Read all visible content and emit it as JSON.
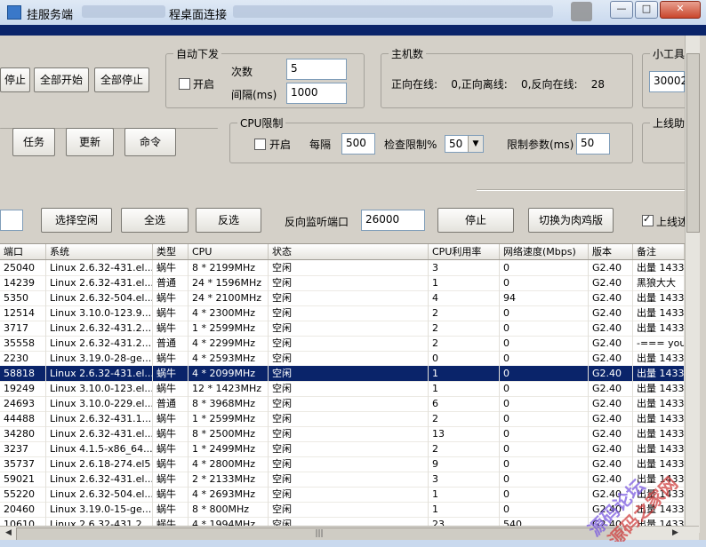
{
  "window": {
    "title_left": "挂服务端",
    "title_right": "程桌面连接"
  },
  "toolbar": {
    "btn_stop_partial": "停止",
    "btn_start_all": "全部开始",
    "btn_stop_all": "全部停止",
    "btn_task": "任务",
    "btn_update": "更新",
    "btn_command": "命令"
  },
  "auto_dispatch": {
    "legend": "自动下发",
    "enable_label": "开启",
    "count_label": "次数",
    "count_value": "5",
    "interval_label": "间隔(ms)",
    "interval_value": "1000"
  },
  "hosts": {
    "legend": "主机数",
    "stats": "正向在线:    0,正向离线:    0,反向在线:    28"
  },
  "tools": {
    "legend_partial": "小工具",
    "value": "30002"
  },
  "cpu_limit": {
    "legend": "CPU限制",
    "enable_label": "开启",
    "every_label": "每隔",
    "every_value": "500",
    "check_label": "检查限制%",
    "check_value": "50",
    "param_label": "限制参数(ms)",
    "param_value": "50"
  },
  "online_assist": {
    "legend_partial": "上线助"
  },
  "row3": {
    "select_idle": "选择空闲",
    "select_all": "全选",
    "invert": "反选",
    "listen_label": "反向监听端口",
    "listen_value": "26000",
    "stop": "停止",
    "switch": "切换为肉鸡版",
    "online_label": "上线述"
  },
  "table": {
    "headers": [
      "端口",
      "系统",
      "类型",
      "CPU",
      "状态",
      "CPU利用率",
      "网络速度(Mbps)",
      "版本",
      "备注"
    ],
    "rows": [
      [
        "25040",
        "Linux 2.6.32-431.el...",
        "蜗牛",
        "8 * 2199MHz",
        "空闲",
        "3",
        "0",
        "G2.40",
        "出量 1433"
      ],
      [
        "14239",
        "Linux 2.6.32-431.el...",
        "普通",
        "24 * 1596MHz",
        "空闲",
        "1",
        "0",
        "G2.40",
        "黑狼大大"
      ],
      [
        "5350",
        "Linux 2.6.32-504.el...",
        "蜗牛",
        "24 * 2100MHz",
        "空闲",
        "4",
        "94",
        "G2.40",
        "出量 1433"
      ],
      [
        "12514",
        "Linux 3.10.0-123.9....",
        "蜗牛",
        "4 * 2300MHz",
        "空闲",
        "2",
        "0",
        "G2.40",
        "出量 1433"
      ],
      [
        "3717",
        "Linux 2.6.32-431.2....",
        "蜗牛",
        "1 * 2599MHz",
        "空闲",
        "2",
        "0",
        "G2.40",
        "出量 1433"
      ],
      [
        "35558",
        "Linux 2.6.32-431.2....",
        "普通",
        "4 * 2299MHz",
        "空闲",
        "2",
        "0",
        "G2.40",
        "-=== you ar"
      ],
      [
        "2230",
        "Linux 3.19.0-28-ge...",
        "蜗牛",
        "4 * 2593MHz",
        "空闲",
        "0",
        "0",
        "G2.40",
        "出量 1433"
      ],
      [
        "58818",
        "Linux 2.6.32-431.el...",
        "蜗牛",
        "4 * 2099MHz",
        "空闲",
        "1",
        "0",
        "G2.40",
        "出量 1433"
      ],
      [
        "19249",
        "Linux 3.10.0-123.el...",
        "蜗牛",
        "12 * 1423MHz",
        "空闲",
        "1",
        "0",
        "G2.40",
        "出量 1433"
      ],
      [
        "24693",
        "Linux 3.10.0-229.el...",
        "普通",
        "8 * 3968MHz",
        "空闲",
        "6",
        "0",
        "G2.40",
        "出量 1433"
      ],
      [
        "44488",
        "Linux 2.6.32-431.1....",
        "蜗牛",
        "1 * 2599MHz",
        "空闲",
        "2",
        "0",
        "G2.40",
        "出量 1433"
      ],
      [
        "34280",
        "Linux 2.6.32-431.el...",
        "蜗牛",
        "8 * 2500MHz",
        "空闲",
        "13",
        "0",
        "G2.40",
        "出量 1433"
      ],
      [
        "3237",
        "Linux 4.1.5-x86_64...",
        "蜗牛",
        "1 * 2499MHz",
        "空闲",
        "2",
        "0",
        "G2.40",
        "出量 1433"
      ],
      [
        "35737",
        "Linux 2.6.18-274.el5",
        "蜗牛",
        "4 * 2800MHz",
        "空闲",
        "9",
        "0",
        "G2.40",
        "出量 1433"
      ],
      [
        "59021",
        "Linux 2.6.32-431.el...",
        "蜗牛",
        "2 * 2133MHz",
        "空闲",
        "3",
        "0",
        "G2.40",
        "出量 1433"
      ],
      [
        "55220",
        "Linux 2.6.32-504.el...",
        "蜗牛",
        "4 * 2693MHz",
        "空闲",
        "1",
        "0",
        "G2.40",
        "出量 1433"
      ],
      [
        "20460",
        "Linux 3.19.0-15-ge...",
        "蜗牛",
        "8 * 800MHz",
        "空闲",
        "1",
        "0",
        "G2.40",
        "出量 1433"
      ],
      [
        "10610",
        "Linux 2.6.32-431.2....",
        "蜗牛",
        "4 * 1994MHz",
        "空闲",
        "23",
        "540",
        "G2.40",
        "出量 1433"
      ]
    ],
    "selected_row": 7
  },
  "watermark": {
    "line1": "源码论坛",
    "line2": "源码之家网"
  },
  "colors": {
    "selection": "#0a246a",
    "face": "#d4d0c8"
  }
}
